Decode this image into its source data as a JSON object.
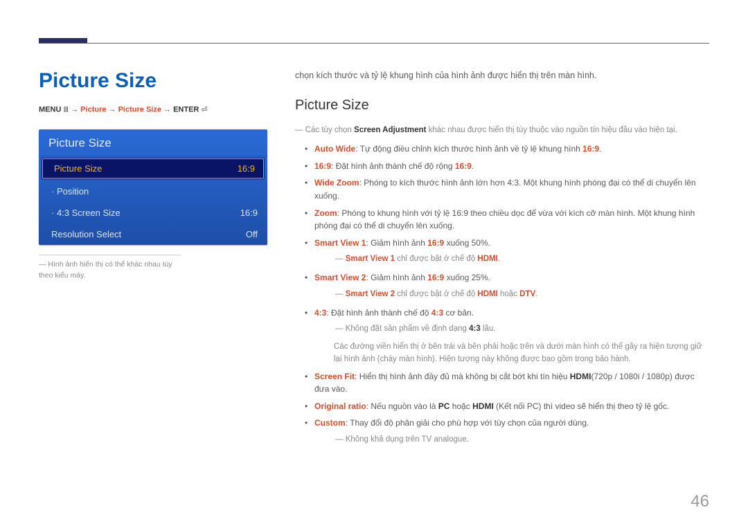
{
  "pageNumber": "46",
  "heading": "Picture Size",
  "breadcrumb": {
    "menu": "MENU",
    "arrow": " → ",
    "p1": "Picture",
    "p2": "Picture Size",
    "enter": "ENTER"
  },
  "osd": {
    "title": "Picture Size",
    "rows": [
      {
        "label": "Picture Size",
        "value": "16:9",
        "selected": true
      },
      {
        "label": "Position",
        "value": "",
        "bullet": true
      },
      {
        "label": "4:3 Screen Size",
        "value": "16:9",
        "bullet": true
      },
      {
        "label": "Resolution Select",
        "value": "Off"
      }
    ]
  },
  "leftFootnote": "Hình ảnh hiển thị có thể khác nhau tùy theo kiểu máy.",
  "right": {
    "intro": "chọn kích thước và tỷ lệ khung hình của hình ảnh được hiển thị trên màn hình.",
    "subhead": "Picture Size",
    "note_top_a": "Các tùy chọn ",
    "note_top_b": "Screen Adjustment",
    "note_top_c": " khác nhau được hiển thị tùy thuộc vào nguồn tín hiệu đầu vào hiện tại.",
    "items": {
      "autoWide": {
        "k": "Auto Wide",
        "t": ": Tự động điều chỉnh kích thước hình ảnh về tỷ lệ khung hình ",
        "k2": "16:9",
        "t2": "."
      },
      "sixteenNine": {
        "k": "16:9",
        "t": ": Đặt hình ảnh thành chế độ rộng ",
        "k2": "16:9",
        "t2": "."
      },
      "wideZoom": {
        "k": "Wide Zoom",
        "t": ": Phóng to kích thước hình ảnh lớn hơn 4:3. Một khung hình phóng đại có thể di chuyển lên xuống."
      },
      "zoom": {
        "k": "Zoom",
        "t": ": Phóng to khung hình với tỷ lệ 16:9 theo chiều dọc để vừa với kích cỡ màn hình. Một khung hình phóng đại có thể di chuyển lên xuống."
      },
      "sv1": {
        "k": "Smart View 1",
        "t1": ": Giảm hình ảnh ",
        "k2": "16:9",
        "t2": " xuống 50%."
      },
      "sv1note": {
        "a": "Smart View 1",
        "b": " chỉ được bật ở chế độ ",
        "c": "HDMI",
        "d": "."
      },
      "sv2": {
        "k": "Smart View 2",
        "t1": ": Giảm hình ảnh ",
        "k2": "16:9",
        "t2": " xuống 25%."
      },
      "sv2note": {
        "a": "Smart View 2",
        "b": " chỉ được bật ở chế độ ",
        "c": "HDMI",
        "d": " hoặc ",
        "e": "DTV",
        "f": "."
      },
      "fourThree": {
        "k": "4:3",
        "t": ": Đặt hình ảnh thành chế độ ",
        "k2": "4:3",
        "t2": " cơ bản."
      },
      "ftnote1": {
        "a": "Không đặt sản phẩm về định dạng ",
        "b": "4:3",
        "c": " lâu."
      },
      "ftnote2": "Các đường viền hiển thị ở bên trái và bên phải hoặc trên và dưới màn hình có thể gây ra hiện tượng giữ lại hình ảnh (cháy màn hình). Hiện tượng này không được bao gồm trong bảo hành.",
      "screenFit": {
        "k": "Screen Fit",
        "t": ": Hiển thị hình ảnh đầy đủ mà không bị cắt bớt khi tín hiệu ",
        "k2": "HDMI",
        "t2": "(720p / 1080i / 1080p) được đưa vào."
      },
      "original": {
        "k": "Original ratio",
        "t": ": Nếu nguồn vào là ",
        "k2": "PC",
        "t2": " hoặc ",
        "k3": "HDMI",
        "t3": " (Kết nối PC) thì video sẽ hiển thị theo tỷ lệ gốc."
      },
      "custom": {
        "k": "Custom",
        "t": ": Thay đổi độ phân giải cho phù hợp với tùy chọn của người dùng."
      },
      "customNote": "Không khả dụng trên TV analogue."
    }
  }
}
